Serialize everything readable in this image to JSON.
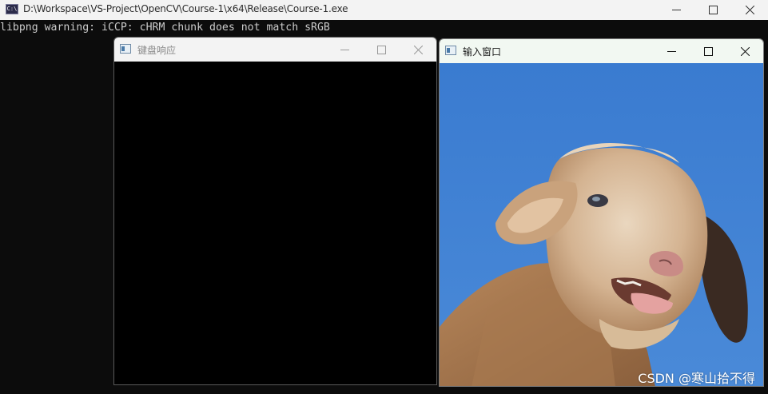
{
  "console": {
    "title": "D:\\Workspace\\VS-Project\\OpenCV\\Course-1\\x64\\Release\\Course-1.exe",
    "app_icon_text": "C:\\",
    "output_line": "libpng warning: iCCP: cHRM chunk does not match sRGB"
  },
  "keyboard_window": {
    "title": "键盘响应"
  },
  "input_window": {
    "title": "输入窗口",
    "image_subject": "sheep"
  },
  "watermark": "CSDN @寒山拾不得",
  "colors": {
    "console_bg": "#0c0c0c",
    "sky": "#3b7ed1",
    "wool": "#c89a6a"
  }
}
